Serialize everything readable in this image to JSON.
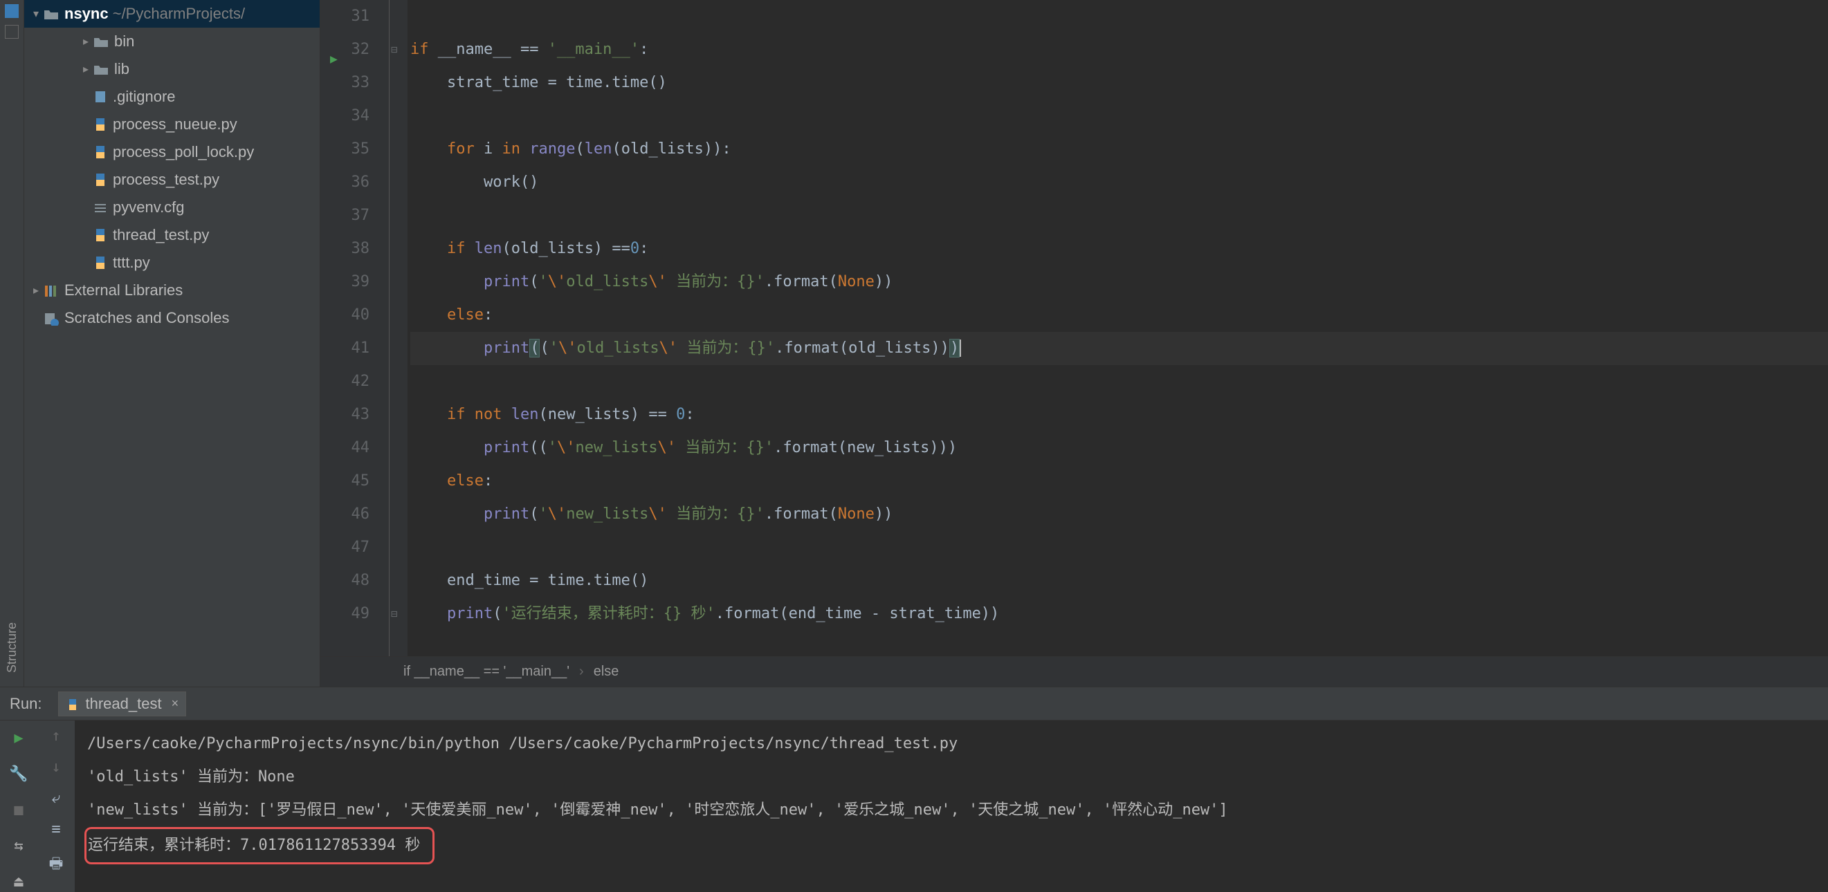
{
  "project": {
    "name": "nsync",
    "path": "~/PycharmProjects/",
    "tree": [
      {
        "kind": "folder",
        "name": "bin",
        "indent": 2,
        "expanded": false,
        "arrow": true
      },
      {
        "kind": "folder",
        "name": "lib",
        "indent": 2,
        "expanded": false,
        "arrow": true
      },
      {
        "kind": "file-git",
        "name": ".gitignore",
        "indent": 2
      },
      {
        "kind": "file-py",
        "name": "process_nueue.py",
        "indent": 2
      },
      {
        "kind": "file-py",
        "name": "process_poll_lock.py",
        "indent": 2
      },
      {
        "kind": "file-py",
        "name": "process_test.py",
        "indent": 2
      },
      {
        "kind": "file-cfg",
        "name": "pyvenv.cfg",
        "indent": 2
      },
      {
        "kind": "file-py",
        "name": "thread_test.py",
        "indent": 2
      },
      {
        "kind": "file-py",
        "name": "tttt.py",
        "indent": 2
      }
    ],
    "external_libraries": "External Libraries",
    "scratches": "Scratches and Consoles"
  },
  "left_stripe": {
    "structure": "Structure"
  },
  "editor": {
    "lines": [
      {
        "n": 31,
        "html": ""
      },
      {
        "n": 32,
        "run": true,
        "fold": "open",
        "html": "<span class='kw'>if</span> __name__ == <span class='str'>'__main__'</span>:"
      },
      {
        "n": 33,
        "html": "    strat_time = time.time()"
      },
      {
        "n": 34,
        "html": ""
      },
      {
        "n": 35,
        "html": "    <span class='kw'>for</span> i <span class='kw'>in</span> <span class='bi'>range</span>(<span class='bi'>len</span>(old_lists)):"
      },
      {
        "n": 36,
        "html": "        work()"
      },
      {
        "n": 37,
        "html": ""
      },
      {
        "n": 38,
        "html": "    <span class='kw'>if</span> <span class='bi'>len</span>(old_lists) ==<span class='nm'>0</span>:"
      },
      {
        "n": 39,
        "html": "        <span class='bi'>print</span>(<span class='str'>'<span class='kw'>\\'</span>old_lists<span class='kw'>\\'</span> 当前为：{}'</span>.format(<span class='kw'>None</span>))"
      },
      {
        "n": 40,
        "html": "    <span class='kw'>else</span>:"
      },
      {
        "n": 41,
        "hl": true,
        "html": "        <span class='bi'>print</span><span class='paren-hl'>(</span>(<span class='str'>'<span class='kw'>\\'</span>old_lists<span class='kw'>\\'</span> 当前为：{}'</span>.format(old_lists))<span class='paren-hl'>)</span><span class='cursor'></span>"
      },
      {
        "n": 42,
        "html": ""
      },
      {
        "n": 43,
        "html": "    <span class='kw'>if not</span> <span class='bi'>len</span>(new_lists) == <span class='nm'>0</span>:"
      },
      {
        "n": 44,
        "html": "        <span class='bi'>print</span>((<span class='str'>'<span class='kw'>\\'</span>new_lists<span class='kw'>\\'</span> 当前为：{}'</span>.format(new_lists)))"
      },
      {
        "n": 45,
        "html": "    <span class='kw'>else</span>:"
      },
      {
        "n": 46,
        "html": "        <span class='bi'>print</span>(<span class='str'>'<span class='kw'>\\'</span>new_lists<span class='kw'>\\'</span> 当前为：{}'</span>.format(<span class='kw'>None</span>))"
      },
      {
        "n": 47,
        "html": ""
      },
      {
        "n": 48,
        "html": "    end_time = time.time()"
      },
      {
        "n": 49,
        "fold": "close",
        "html": "    <span class='bi'>print</span>(<span class='str'>'运行结束，累计耗时：{} 秒'</span>.format(end_time - strat_time))"
      }
    ],
    "breadcrumb": [
      "if __name__ == '__main__'",
      "else"
    ]
  },
  "run": {
    "label": "Run:",
    "tab": "thread_test",
    "console_lines": [
      "/Users/caoke/PycharmProjects/nsync/bin/python /Users/caoke/PycharmProjects/nsync/thread_test.py",
      "'old_lists' 当前为：None",
      "'new_lists' 当前为：['罗马假日_new', '天使爱美丽_new', '倒霉爱神_new', '时空恋旅人_new', '爱乐之城_new', '天使之城_new', '怦然心动_new']",
      "运行结束，累计耗时：7.017861127853394 秒"
    ]
  }
}
